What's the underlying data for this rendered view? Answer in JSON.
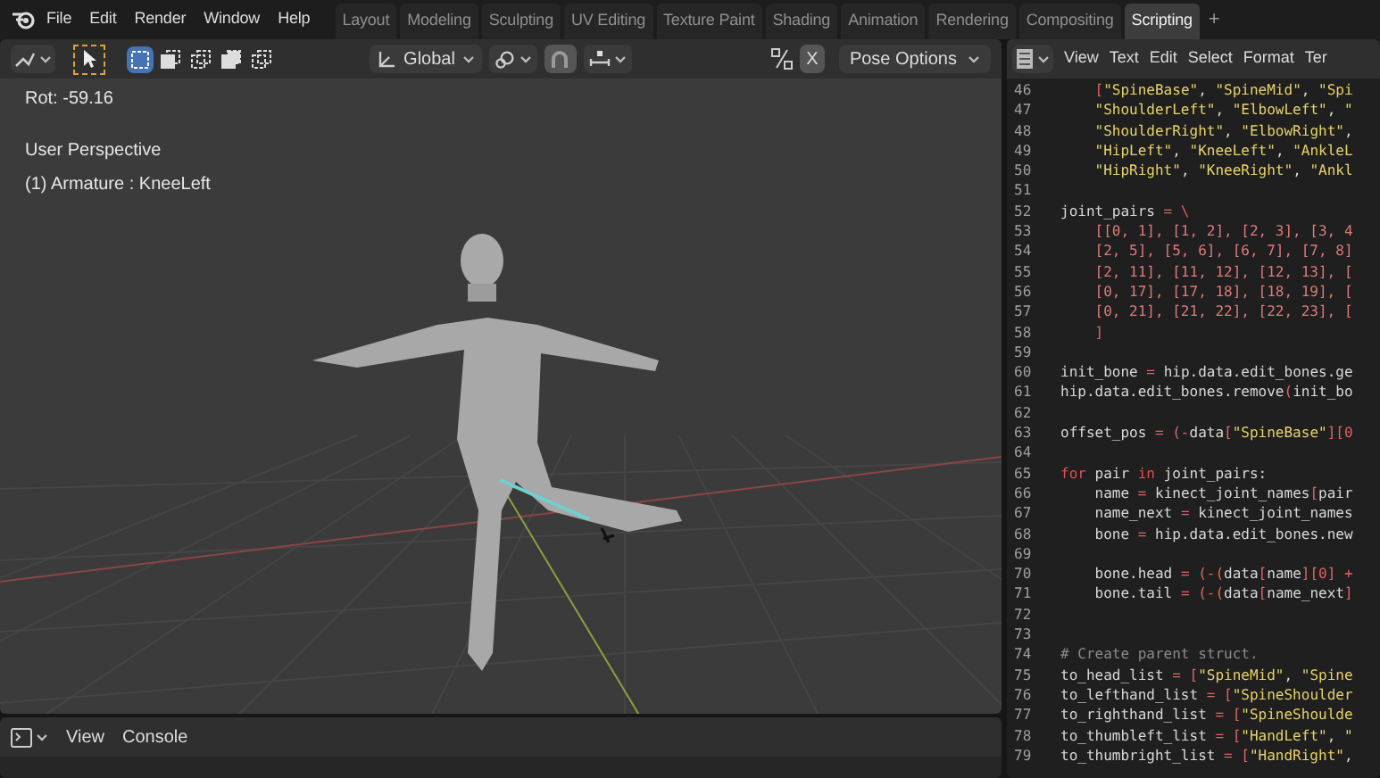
{
  "menu": [
    "File",
    "Edit",
    "Render",
    "Window",
    "Help"
  ],
  "workspace_tabs": [
    {
      "label": "Layout",
      "selected": false
    },
    {
      "label": "Modeling",
      "selected": false
    },
    {
      "label": "Sculpting",
      "selected": false
    },
    {
      "label": "UV Editing",
      "selected": false
    },
    {
      "label": "Texture Paint",
      "selected": false
    },
    {
      "label": "Shading",
      "selected": false
    },
    {
      "label": "Animation",
      "selected": false
    },
    {
      "label": "Rendering",
      "selected": false
    },
    {
      "label": "Compositing",
      "selected": false
    },
    {
      "label": "Scripting",
      "selected": true
    }
  ],
  "add_tab": "+",
  "viewport": {
    "transform_orientation": "Global",
    "pose_options": "Pose Options",
    "x_mirror": "X",
    "select_modes": [
      {
        "selected": true
      },
      {
        "selected": false
      },
      {
        "selected": false
      },
      {
        "selected": false
      },
      {
        "selected": false
      }
    ],
    "rotation": "Rot: -59.16",
    "view_name": "User Perspective",
    "active_object": "(1) Armature : KneeLeft"
  },
  "console": {
    "menu": [
      "View",
      "Console"
    ]
  },
  "text_editor": {
    "menu": [
      "View",
      "Text",
      "Edit",
      "Select",
      "Format",
      "Ter"
    ],
    "lines": [
      {
        "n": "46",
        "tokens": [
          {
            "kind": "op",
            "text": "    ["
          },
          {
            "kind": "str",
            "text": "\"SpineBase\""
          },
          {
            "kind": "txt",
            "text": ", "
          },
          {
            "kind": "str",
            "text": "\"SpineMid\""
          },
          {
            "kind": "txt",
            "text": ", "
          },
          {
            "kind": "str",
            "text": "\"Spi"
          }
        ]
      },
      {
        "n": "47",
        "tokens": [
          {
            "kind": "str",
            "text": "    \"ShoulderLeft\""
          },
          {
            "kind": "txt",
            "text": ", "
          },
          {
            "kind": "str",
            "text": "\"ElbowLeft\""
          },
          {
            "kind": "txt",
            "text": ", "
          },
          {
            "kind": "str",
            "text": "\""
          }
        ]
      },
      {
        "n": "48",
        "tokens": [
          {
            "kind": "str",
            "text": "    \"ShoulderRight\""
          },
          {
            "kind": "txt",
            "text": ", "
          },
          {
            "kind": "str",
            "text": "\"ElbowRight\""
          },
          {
            "kind": "txt",
            "text": ","
          }
        ]
      },
      {
        "n": "49",
        "tokens": [
          {
            "kind": "str",
            "text": "    \"HipLeft\""
          },
          {
            "kind": "txt",
            "text": ", "
          },
          {
            "kind": "str",
            "text": "\"KneeLeft\""
          },
          {
            "kind": "txt",
            "text": ", "
          },
          {
            "kind": "str",
            "text": "\"AnkleL"
          }
        ]
      },
      {
        "n": "50",
        "tokens": [
          {
            "kind": "str",
            "text": "    \"HipRight\""
          },
          {
            "kind": "txt",
            "text": ", "
          },
          {
            "kind": "str",
            "text": "\"KneeRight\""
          },
          {
            "kind": "txt",
            "text": ", "
          },
          {
            "kind": "str",
            "text": "\"Ankl"
          }
        ]
      },
      {
        "n": "51"
      },
      {
        "n": "52",
        "tokens": [
          {
            "kind": "txt",
            "text": "joint_pairs "
          },
          {
            "kind": "op",
            "text": "= \\"
          }
        ]
      },
      {
        "n": "53",
        "tokens": [
          {
            "kind": "num",
            "text": "    [[0, 1], [1, 2], [2, 3], [3, 4"
          }
        ]
      },
      {
        "n": "54",
        "tokens": [
          {
            "kind": "num",
            "text": "    [2, 5], [5, 6], [6, 7], [7, 8]"
          }
        ]
      },
      {
        "n": "55",
        "tokens": [
          {
            "kind": "num",
            "text": "    [2, 11], [11, 12], [12, 13], ["
          }
        ]
      },
      {
        "n": "56",
        "tokens": [
          {
            "kind": "num",
            "text": "    [0, 17], [17, 18], [18, 19], ["
          }
        ]
      },
      {
        "n": "57",
        "tokens": [
          {
            "kind": "num",
            "text": "    [0, 21], [21, 22], [22, 23], ["
          }
        ]
      },
      {
        "n": "58",
        "tokens": [
          {
            "kind": "op",
            "text": "    ]"
          }
        ]
      },
      {
        "n": "59"
      },
      {
        "n": "60",
        "tokens": [
          {
            "kind": "txt",
            "text": "init_bone "
          },
          {
            "kind": "op",
            "text": "="
          },
          {
            "kind": "txt",
            "text": " hip.data.edit_bones.ge"
          }
        ]
      },
      {
        "n": "61",
        "tokens": [
          {
            "kind": "txt",
            "text": "hip.data.edit_bones.remove"
          },
          {
            "kind": "op",
            "text": "("
          },
          {
            "kind": "txt",
            "text": "init_bo"
          }
        ]
      },
      {
        "n": "62"
      },
      {
        "n": "63",
        "tokens": [
          {
            "kind": "txt",
            "text": "offset_pos "
          },
          {
            "kind": "op",
            "text": "= (-"
          },
          {
            "kind": "txt",
            "text": "data"
          },
          {
            "kind": "op",
            "text": "["
          },
          {
            "kind": "str",
            "text": "\"SpineBase\""
          },
          {
            "kind": "op",
            "text": "][0"
          }
        ]
      },
      {
        "n": "64"
      },
      {
        "n": "65",
        "tokens": [
          {
            "kind": "kw",
            "text": "for"
          },
          {
            "kind": "txt",
            "text": " pair "
          },
          {
            "kind": "kw",
            "text": "in"
          },
          {
            "kind": "txt",
            "text": " joint_pairs:"
          }
        ]
      },
      {
        "n": "66",
        "tokens": [
          {
            "kind": "txt",
            "text": "    name "
          },
          {
            "kind": "op",
            "text": "="
          },
          {
            "kind": "txt",
            "text": " kinect_joint_names"
          },
          {
            "kind": "op",
            "text": "["
          },
          {
            "kind": "txt",
            "text": "pair"
          }
        ]
      },
      {
        "n": "67",
        "tokens": [
          {
            "kind": "txt",
            "text": "    name_next "
          },
          {
            "kind": "op",
            "text": "="
          },
          {
            "kind": "txt",
            "text": " kinect_joint_names"
          }
        ]
      },
      {
        "n": "68",
        "tokens": [
          {
            "kind": "txt",
            "text": "    bone "
          },
          {
            "kind": "op",
            "text": "="
          },
          {
            "kind": "txt",
            "text": " hip.data.edit_bones.new"
          }
        ]
      },
      {
        "n": "69"
      },
      {
        "n": "70",
        "tokens": [
          {
            "kind": "txt",
            "text": "    bone.head "
          },
          {
            "kind": "op",
            "text": "= (-("
          },
          {
            "kind": "txt",
            "text": "data"
          },
          {
            "kind": "op",
            "text": "["
          },
          {
            "kind": "txt",
            "text": "name"
          },
          {
            "kind": "op",
            "text": "][0] +"
          }
        ]
      },
      {
        "n": "71",
        "tokens": [
          {
            "kind": "txt",
            "text": "    bone.tail "
          },
          {
            "kind": "op",
            "text": "= (-("
          },
          {
            "kind": "txt",
            "text": "data"
          },
          {
            "kind": "op",
            "text": "["
          },
          {
            "kind": "txt",
            "text": "name_next"
          },
          {
            "kind": "op",
            "text": "]"
          }
        ]
      },
      {
        "n": "72"
      },
      {
        "n": "73"
      },
      {
        "n": "74",
        "tokens": [
          {
            "kind": "cmt",
            "text": "# Create parent struct."
          }
        ]
      },
      {
        "n": "75",
        "tokens": [
          {
            "kind": "txt",
            "text": "to_head_list "
          },
          {
            "kind": "op",
            "text": "= ["
          },
          {
            "kind": "str",
            "text": "\"SpineMid\""
          },
          {
            "kind": "txt",
            "text": ", "
          },
          {
            "kind": "str",
            "text": "\"Spine"
          }
        ]
      },
      {
        "n": "76",
        "tokens": [
          {
            "kind": "txt",
            "text": "to_lefthand_list "
          },
          {
            "kind": "op",
            "text": "= ["
          },
          {
            "kind": "str",
            "text": "\"SpineShoulder"
          }
        ]
      },
      {
        "n": "77",
        "tokens": [
          {
            "kind": "txt",
            "text": "to_righthand_list "
          },
          {
            "kind": "op",
            "text": "= ["
          },
          {
            "kind": "str",
            "text": "\"SpineShoulde"
          }
        ]
      },
      {
        "n": "78",
        "tokens": [
          {
            "kind": "txt",
            "text": "to_thumbleft_list "
          },
          {
            "kind": "op",
            "text": "= ["
          },
          {
            "kind": "str",
            "text": "\"HandLeft\""
          },
          {
            "kind": "txt",
            "text": ", "
          },
          {
            "kind": "str",
            "text": "\""
          }
        ]
      },
      {
        "n": "79",
        "tokens": [
          {
            "kind": "txt",
            "text": "to_thumbright_list "
          },
          {
            "kind": "op",
            "text": "= ["
          },
          {
            "kind": "str",
            "text": "\"HandRight\""
          },
          {
            "kind": "txt",
            "text": ","
          }
        ]
      }
    ]
  }
}
